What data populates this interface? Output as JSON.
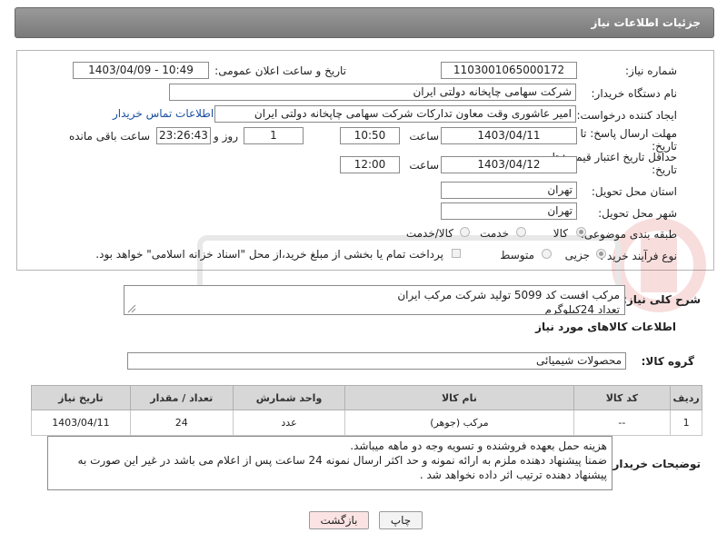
{
  "header": {
    "title": "جزئیات اطلاعات نیاز"
  },
  "form": {
    "need_number_label": "شماره نیاز:",
    "need_number": "1103001065000172",
    "announce_label": "تاریخ و ساعت اعلان عمومی:",
    "announce_value": "1403/04/09 - 10:49",
    "buyer_org_label": "نام دستگاه خریدار:",
    "buyer_org": "شرکت سهامی چاپخانه دولتی ایران",
    "creator_label": "ایجاد کننده درخواست:",
    "creator": "امیر عاشوری وقت معاون تدارکات شرکت سهامی چاپخانه دولتی ایران",
    "contact_link": "اطلاعات تماس خریدار",
    "reply_deadline_label_1": "مهلت ارسال پاسخ: تا",
    "reply_deadline_label_2": "تاریخ:",
    "reply_date": "1403/04/11",
    "time_label": "ساعت",
    "reply_time": "10:50",
    "days_value": "1",
    "days_label": "روز و",
    "remaining_time": "23:26:43",
    "remaining_label": "ساعت باقی مانده",
    "price_deadline_label_1": "حداقل تاریخ اعتبار قیمت: تا",
    "price_deadline_label_2": "تاریخ:",
    "price_date": "1403/04/12",
    "price_time": "12:00",
    "province_label": "استان محل تحویل:",
    "province": "تهران",
    "city_label": "شهر محل تحویل:",
    "city": "تهران",
    "category_label": "طبقه بندی موضوعی:",
    "category_options": [
      "کالا",
      "خدمت",
      "کالا/خدمت"
    ],
    "category_selected": 0,
    "process_label": "نوع فرآیند خرید :",
    "process_options": [
      "جزیی",
      "متوسط"
    ],
    "process_selected": 0,
    "payment_note": "پرداخت تمام یا بخشی از مبلغ خرید،از محل \"اسناد خزانه اسلامی\" خواهد بود."
  },
  "summary": {
    "label": "شرح کلی نیاز:",
    "line1": "مرکب افست کد 5099 تولید شرکت مرکب ایران",
    "line2": "تعداد 24کیلوگرم"
  },
  "goods": {
    "section_title": "اطلاعات کالاهای مورد نیاز",
    "group_label": "گروه کالا:",
    "group_value": "محصولات شیمیائی",
    "columns": [
      "ردیف",
      "کد کالا",
      "نام کالا",
      "واحد شمارش",
      "تعداد / مقدار",
      "تاریخ نیاز"
    ],
    "rows": [
      [
        "1",
        "--",
        "مرکب (جوهر)",
        "عدد",
        "24",
        "1403/04/11"
      ]
    ]
  },
  "buyer_notes": {
    "label": "توضیحات خریدار:",
    "line1": "هزینه حمل بعهده فروشنده و تسویه وجه دو ماهه  میباشد.",
    "line2": "ضمنا پیشنهاد دهنده ملزم به ارائه نمونه و  حد اکثر ارسال نمونه 24 ساعت پس از اعلام می باشد در غیر این صورت به",
    "line3": "پیشنهاد دهنده ترتیب  اثر داده نخواهد شد ."
  },
  "buttons": {
    "print": "چاپ",
    "back": "بازگشت"
  },
  "colors": {
    "header_bg": "#8a8a8a",
    "back_btn_bg": "#fbe3e3",
    "link": "#1a4fa0"
  }
}
